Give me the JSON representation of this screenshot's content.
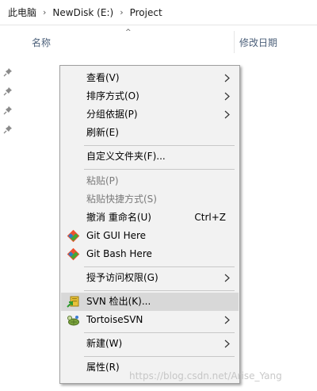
{
  "breadcrumb": [
    "此电脑",
    "NewDisk (E:)",
    "Project"
  ],
  "breadcrumb_separator": "›",
  "columns": {
    "name": "名称",
    "date_modified": "修改日期"
  },
  "sort_indicator": "^",
  "context_menu": {
    "items": [
      {
        "label": "查看(V)",
        "submenu": true
      },
      {
        "label": "排序方式(O)",
        "submenu": true
      },
      {
        "label": "分组依据(P)",
        "submenu": true
      },
      {
        "label": "刷新(E)"
      },
      {
        "label": "自定义文件夹(F)..."
      },
      {
        "label": "粘贴(P)",
        "disabled": true
      },
      {
        "label": "粘贴快捷方式(S)",
        "disabled": true
      },
      {
        "label": "撤消 重命名(U)",
        "shortcut": "Ctrl+Z"
      },
      {
        "label": "Git GUI Here",
        "icon": "git-icon"
      },
      {
        "label": "Git Bash Here",
        "icon": "git-icon"
      },
      {
        "label": "授予访问权限(G)",
        "submenu": true
      },
      {
        "label": "SVN 检出(K)...",
        "icon": "svn-checkout-icon",
        "highlighted": true
      },
      {
        "label": "TortoiseSVN",
        "icon": "tortoisesvn-icon",
        "submenu": true
      },
      {
        "label": "新建(W)",
        "submenu": true
      },
      {
        "label": "属性(R)"
      }
    ]
  },
  "watermark": "https://blog.csdn.net/Arise_Yang",
  "colors": {
    "menu_background": "#f2f2f2",
    "menu_highlight": "#d8d8d8",
    "disabled_text": "#7a7a7a",
    "column_header_text": "#4c607a"
  }
}
